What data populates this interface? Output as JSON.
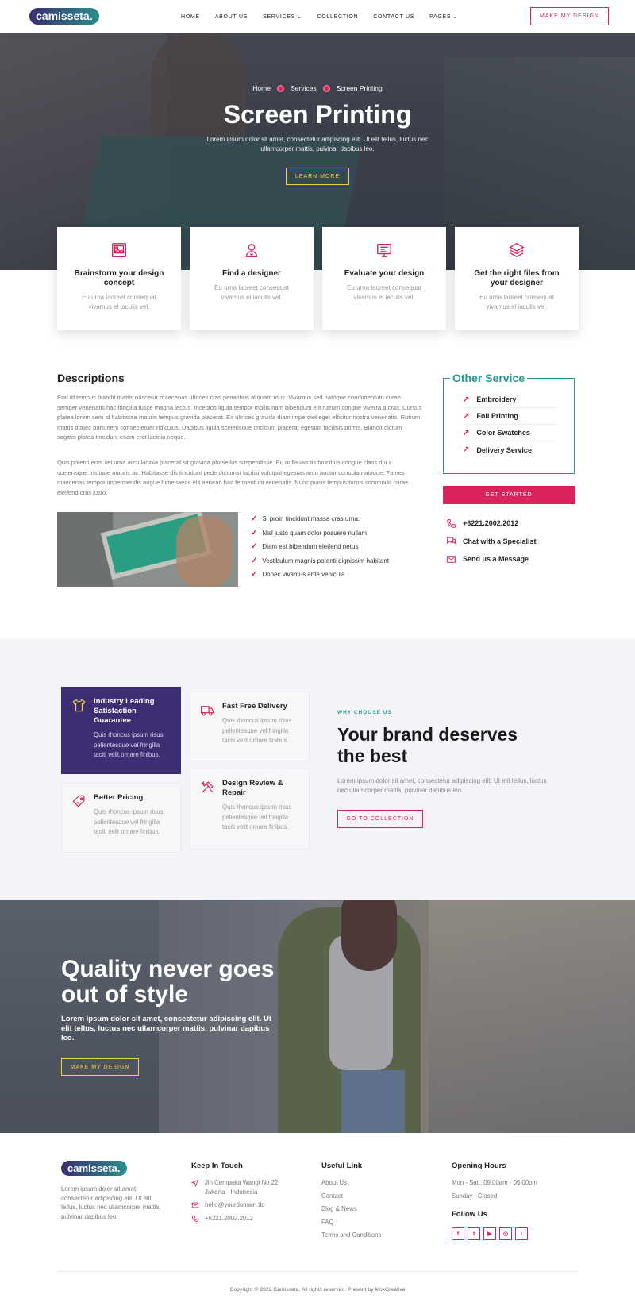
{
  "header": {
    "logo": "camisseta.",
    "nav": [
      {
        "label": "HOME"
      },
      {
        "label": "ABOUT US"
      },
      {
        "label": "SERVICES"
      },
      {
        "label": "COLLECTION"
      },
      {
        "label": "CONTACT US"
      },
      {
        "label": "PAGES"
      }
    ],
    "cta": "MAKE MY DESIGN"
  },
  "hero": {
    "breadcrumb": [
      "Home",
      "Services",
      "Screen Printing"
    ],
    "title": "Screen Printing",
    "subtitle": "Lorem ipsum dolor sit amet, consectetur adipiscing elit. Ut elit tellus, luctus nec ullamcorper mattis, pulvinar dapibus leo.",
    "button": "LEARN MORE"
  },
  "features": [
    {
      "icon": "image-icon",
      "title": "Brainstorm your design concept",
      "text": "Eu urna laoreet consequat vivamus el iaculis vel."
    },
    {
      "icon": "designer-icon",
      "title": "Find a designer",
      "text": "Eu urna laoreet consequat vivamus el iaculis vel."
    },
    {
      "icon": "monitor-icon",
      "title": "Evaluate your design",
      "text": "Eu urna laoreet consequat vivamus el iaculis vel."
    },
    {
      "icon": "layers-icon",
      "title": "Get the right files from your designer",
      "text": "Eu urna laoreet consequat vivamus el iaculis vel."
    }
  ],
  "descriptions": {
    "title": "Descriptions",
    "p1": "Erat id tempus blandit mattis nascetur maecenas ultrices cras penatibus aliquam mus. Vivamus sed natoque condimentum curae semper venenatis hac fringilla fusce magna lectus. Inceptos ligula tempor mollis nam bibendum elit rutrum congue viverra a cras. Cursus platea lorem sem id habitasse mauris tempus gravida placerat. Ex ultrices gravida diam imperdiet eget efficitur nostra venenatis. Rutrum mattis donec parturient consectetuer ridiculus. Dapibus ligula scelerisque tincidunt placerat egestas facilisis primis. Blandit dictum sagittis platea tincidunt etiam erat lacinia neque.",
    "p2": "Quis potenti eros vel urna arcu lacinia placerat sit gravida phasellus suspendisse. Eu nulla iaculis faucibus congue class dui a scelerisque tristique mauris ac. Habitasse dis tincidunt pede dictumst facilisi volutpat egestas arcu auctor conubia natoque. Fames maecenas tempor imperdiet dis augue himenaeos elit aenean hac fermentum venenatis. Nunc purus tempus turpis commodo curae eleifend cras justo.",
    "checklist": [
      "Si proin tincidunt massa cras urna.",
      "Nisl justo quam dolor posuere nullam",
      "Diam est bibendum eleifend netus",
      "Vestibulum magnis potenti dignissim habitant",
      "Donec vivamus ante vehicula"
    ]
  },
  "sidebar": {
    "title": "Other Service",
    "services": [
      "Embroidery",
      "Foil Printing",
      "Color Swatches",
      "Delivery Service"
    ],
    "button": "GET STARTED",
    "contacts": [
      {
        "icon": "phone-icon",
        "label": "+6221.2002.2012"
      },
      {
        "icon": "chat-icon",
        "label": "Chat with a Specialist"
      },
      {
        "icon": "mail-icon",
        "label": "Send us a Message"
      }
    ]
  },
  "why": {
    "cards": [
      {
        "icon": "shirt-icon",
        "title": "Industry Leading Satisfaction Guarantee",
        "text": "Quis rhoncus ipsum risus pellentesque vel fringilla taciti velit ornare finibus."
      },
      {
        "icon": "truck-icon",
        "title": "Fast Free Delivery",
        "text": "Quis rhoncus ipsum risus pellentesque vel fringilla taciti velit ornare finibus."
      },
      {
        "icon": "price-tag-icon",
        "title": "Better Pricing",
        "text": "Quis rhoncus ipsum risus pellentesque vel fringilla taciti velit ornare finibus."
      },
      {
        "icon": "tools-icon",
        "title": "Design Review & Repair",
        "text": "Quis rhoncus ipsum risus pellentesque vel fringilla taciti velit ornare finibus."
      }
    ],
    "label": "WHY CHOOSE US",
    "title": "Your brand deserves the best",
    "text": "Lorem ipsum dolor sit amet, consectetur adipiscing elit. Ut elit tellus, luctus nec ullamcorper mattis, pulvinar dapibus leo.",
    "button": "GO TO COLLECTION"
  },
  "quality": {
    "title": "Quality never goes out of style",
    "text": "Lorem ipsum dolor sit amet, consectetur adipiscing elit. Ut elit tellus, luctus nec ullamcorper mattis, pulvinar dapibus leo.",
    "button": "MAKE MY DESIGN"
  },
  "footer": {
    "logo": "camisseta.",
    "about": "Lorem ipsum dolor sit amet, consectetur adipiscing elit. Ut elit tellus, luctus nec ullamcorper mattis, pulvinar dapibus leo.",
    "keep_title": "Keep In Touch",
    "address": "Jln Cempaka Wangi No 22 Jakarta - Indonesia",
    "email": "hello@yourdomain.tld",
    "phone": "+6221.2002.2012",
    "links_title": "Useful Link",
    "links": [
      "About Us",
      "Contact",
      "Blog & News",
      "FAQ",
      "Terms and Conditions"
    ],
    "hours_title": "Opening Hours",
    "hours": [
      "Mon - Sat : 09.00am - 05.00pm",
      "Sunday : Closed"
    ],
    "follow_title": "Follow Us",
    "socials": [
      {
        "icon": "facebook-icon",
        "glyph": "f"
      },
      {
        "icon": "twitter-icon",
        "glyph": "t"
      },
      {
        "icon": "youtube-icon",
        "glyph": "▶"
      },
      {
        "icon": "instagram-icon",
        "glyph": "◎"
      },
      {
        "icon": "tiktok-icon",
        "glyph": "♪"
      }
    ],
    "copyright": "Copyright © 2022 Camisseta. All rights reserved. Present by MoxCreative"
  },
  "colors": {
    "accent": "#d9235a",
    "teal": "#22998f",
    "purple": "#3d2e74",
    "yellow": "#f2cc45"
  }
}
